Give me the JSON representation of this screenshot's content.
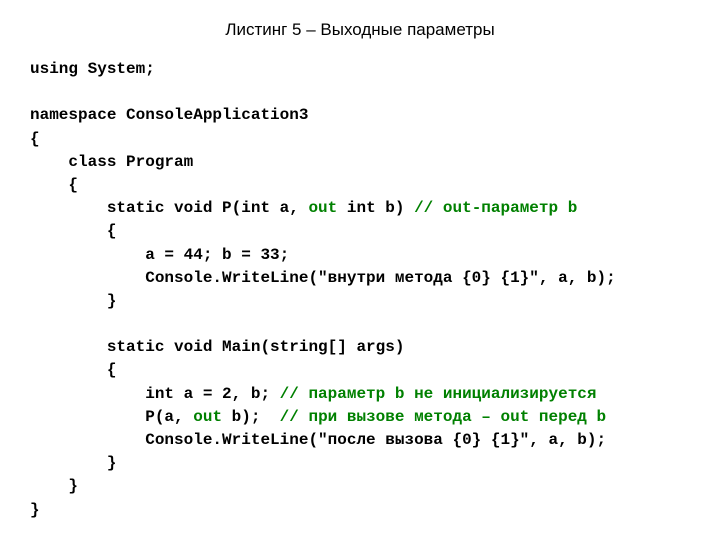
{
  "title": "Листинг 5 – Выходные параметры",
  "code": {
    "l1a": "using System;",
    "l2a": "namespace ConsoleApplication3",
    "l3a": "{",
    "l4a": "    class Program",
    "l5a": "    {",
    "l6a": "        static void P(int a, ",
    "l6b": "out",
    "l6c": " int b) ",
    "l6d": "// out-параметр b",
    "l7a": "        {",
    "l8a": "            a = 44; b = 33;",
    "l9a": "            Console.WriteLine(\"внутри метода {0} {1}\", a, b);",
    "l10a": "        }",
    "l11a": "        static void Main(string[] args)",
    "l12a": "        {",
    "l13a": "            int a = 2, b; ",
    "l13b": "// параметр b не инициализируется",
    "l14a": "            P(a, ",
    "l14b": "out",
    "l14c": " b);  ",
    "l14d": "// при вызове метода – out перед b",
    "l15a": "            Console.WriteLine(\"после вызова {0} {1}\", a, b);",
    "l16a": "        }",
    "l17a": "    }",
    "l18a": "}"
  }
}
